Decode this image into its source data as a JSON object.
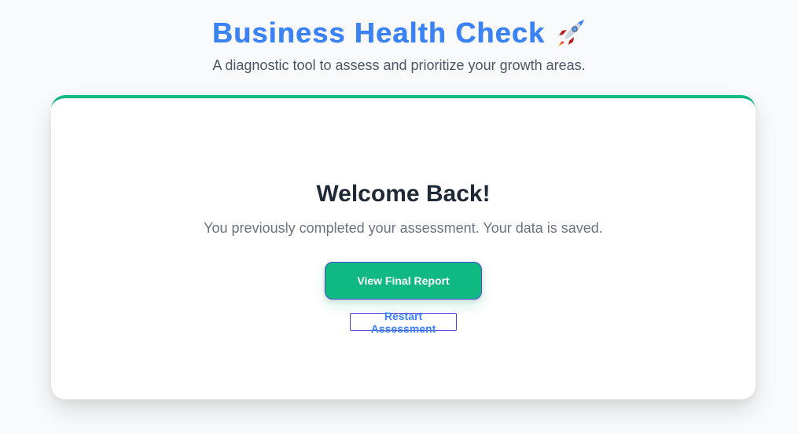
{
  "header": {
    "title": "Business Health Check",
    "subtitle": "A diagnostic tool to assess and prioritize your growth areas.",
    "title_icon": "rocket-icon"
  },
  "card": {
    "heading": "Welcome Back!",
    "description": "You previously completed your assessment. Your data is saved.",
    "primary_button_label": "View Final Report",
    "secondary_button_label": "Restart Assessment"
  },
  "colors": {
    "brand_blue": "#3b82f6",
    "accent_green": "#10b981",
    "focus_outline": "#4f46e5",
    "heading_text": "#1f2937",
    "muted_text": "#6b7280",
    "page_bg": "#f9fafb"
  }
}
